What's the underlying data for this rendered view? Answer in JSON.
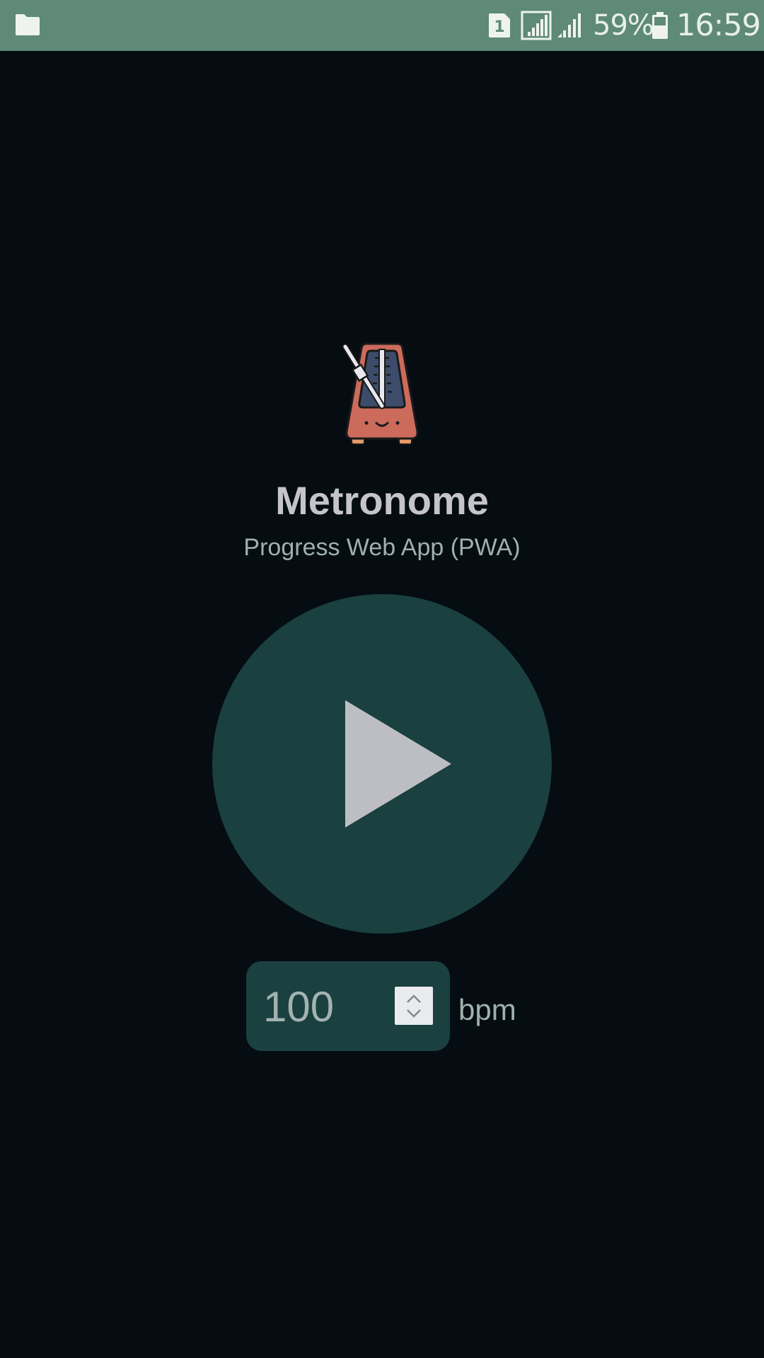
{
  "status_bar": {
    "sim_slot": "1",
    "battery_percent": "59%",
    "time": "16:59",
    "icons": [
      "folder-icon",
      "sim-icon",
      "signal-icon",
      "signal-icon",
      "battery-icon"
    ]
  },
  "app": {
    "title": "Metronome",
    "subtitle": "Progress Web App (PWA)",
    "logo_icon": "metronome-icon"
  },
  "controls": {
    "play_icon": "play-icon",
    "bpm_value": "100",
    "bpm_unit": "bpm"
  },
  "colors": {
    "background": "#050c12",
    "status_bar": "#5e8a77",
    "accent": "#1a4040",
    "text_primary": "#c5c5c9",
    "text_secondary": "#9fb1ac"
  }
}
